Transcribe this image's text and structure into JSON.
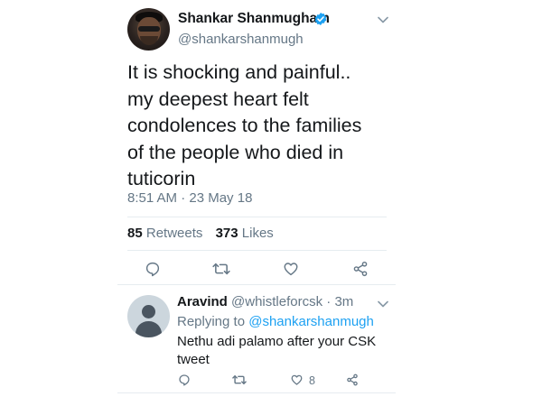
{
  "tweet": {
    "display_name": "Shankar Shanmugham",
    "handle": "@shankarshanmugh",
    "text_lines": [
      "It is shocking and painful..",
      "my deepest heart felt",
      "condolences to the families",
      "of the people who died in",
      "tuticorin"
    ],
    "timestamp": "8:51 AM · 23 May 18",
    "retweets_count": "85",
    "retweets_label": "Retweets",
    "likes_count": "373",
    "likes_label": "Likes",
    "actions": [
      "reply-icon",
      "retweet-icon",
      "like-icon",
      "share-icon"
    ]
  },
  "reply": {
    "display_name": "Aravind",
    "handle": "@whistleforcsk",
    "time": "· 3m",
    "replying_label": "Replying to",
    "replying_to": "@shankarshanmugh",
    "text": "Nethu adi palamo after your CSK tweet",
    "likes_count": "8",
    "actions": [
      "reply-icon",
      "retweet-icon",
      "like-icon",
      "share-icon"
    ]
  },
  "colors": {
    "text": "#14171a",
    "secondary": "#657786",
    "accent": "#1da1f2",
    "divider": "#e6ecf0"
  }
}
